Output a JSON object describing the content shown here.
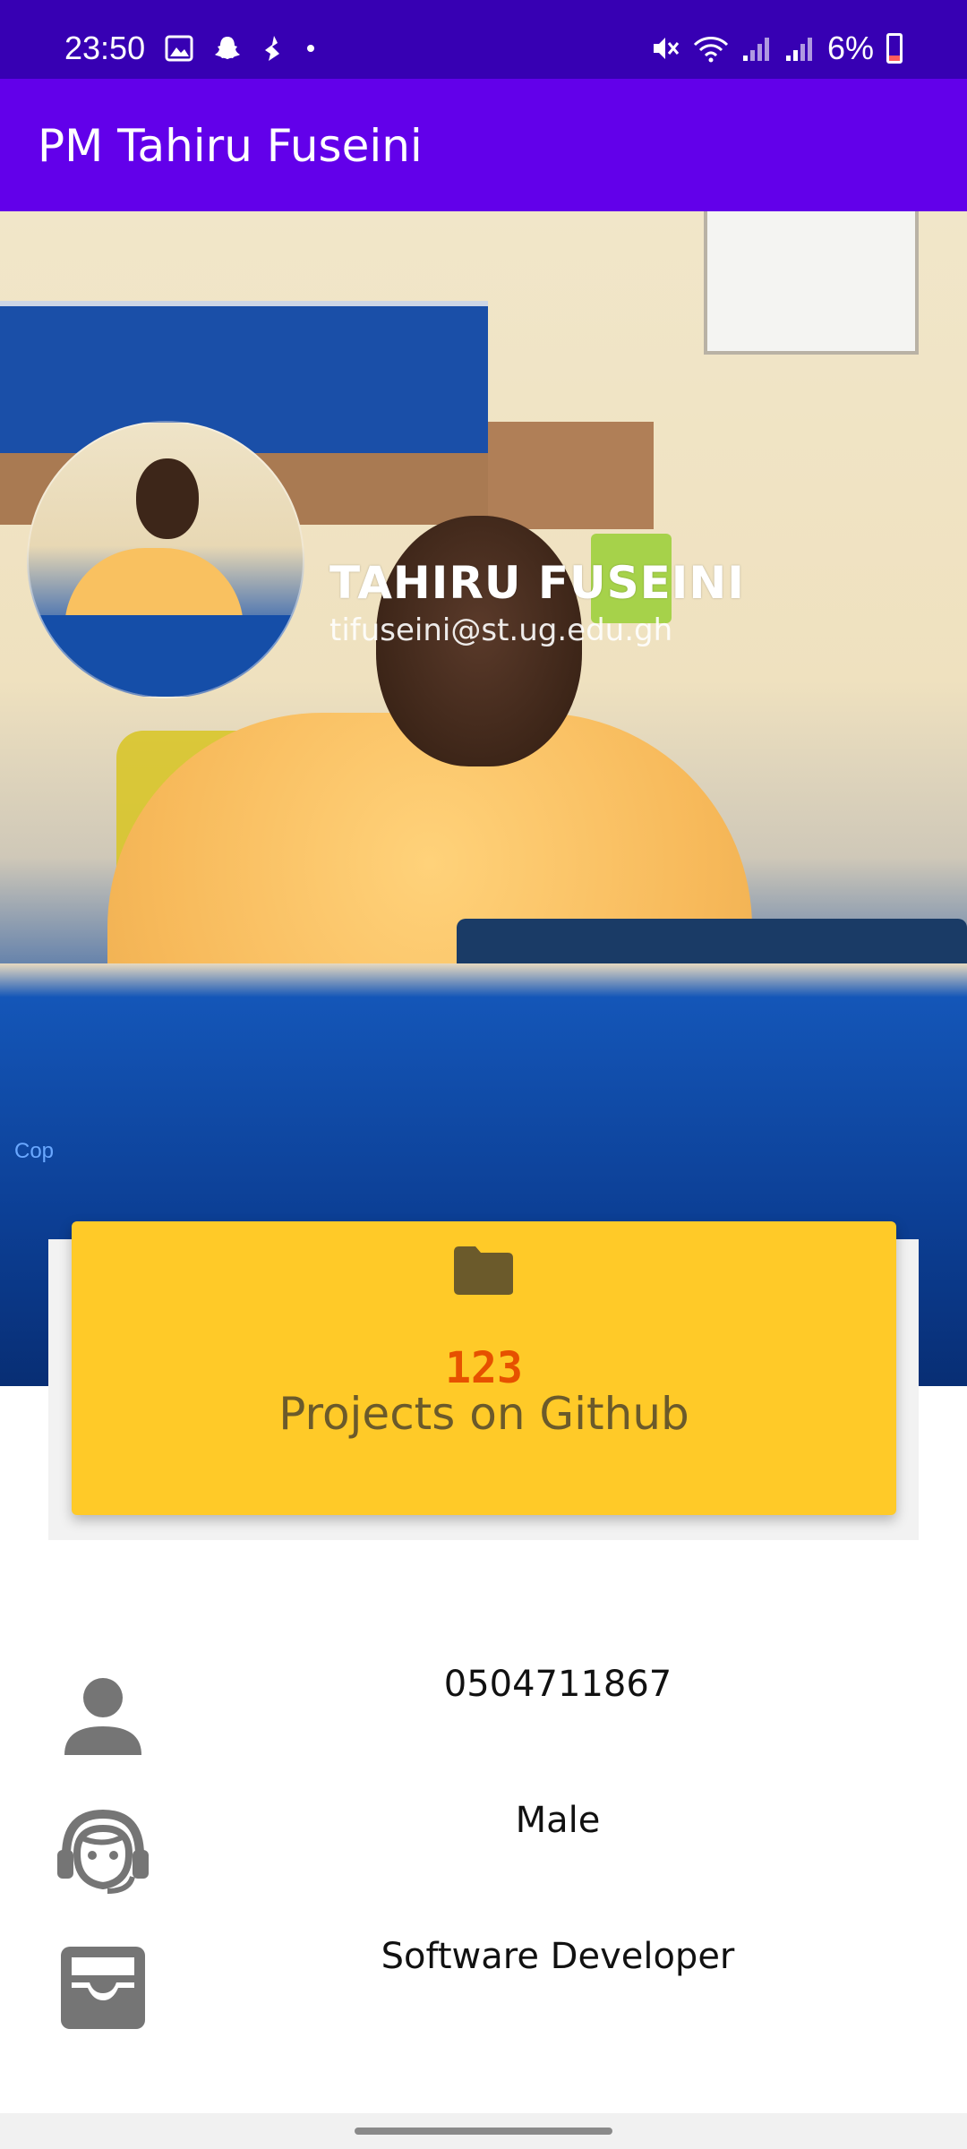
{
  "status_bar": {
    "time": "23:50",
    "battery_percent": "6%",
    "icons_left": [
      "image-icon",
      "snapchat-icon",
      "clean-master-icon",
      "dot-icon"
    ],
    "icons_right": [
      "mute-icon",
      "wifi-icon",
      "signal-icon",
      "signal-icon",
      "battery-icon"
    ]
  },
  "app_bar": {
    "title": "PM Tahiru Fuseini",
    "background": "#6200ea"
  },
  "profile": {
    "name": "TAHIRU FUSEINI",
    "email": "tifuseini@st.ug.edu.gh",
    "photo_credit": "Cop"
  },
  "projects_card": {
    "icon": "folder-icon",
    "count": "123",
    "label": "Projects on Github",
    "background": "#ffca28"
  },
  "info": [
    {
      "icon": "person-icon",
      "text": "0504711867"
    },
    {
      "icon": "support-agent-icon",
      "text": "Male"
    },
    {
      "icon": "inbox-icon",
      "text": "Software Developer"
    }
  ],
  "colors": {
    "status_bar": "#3700b3",
    "accent_text": "#e65100"
  }
}
